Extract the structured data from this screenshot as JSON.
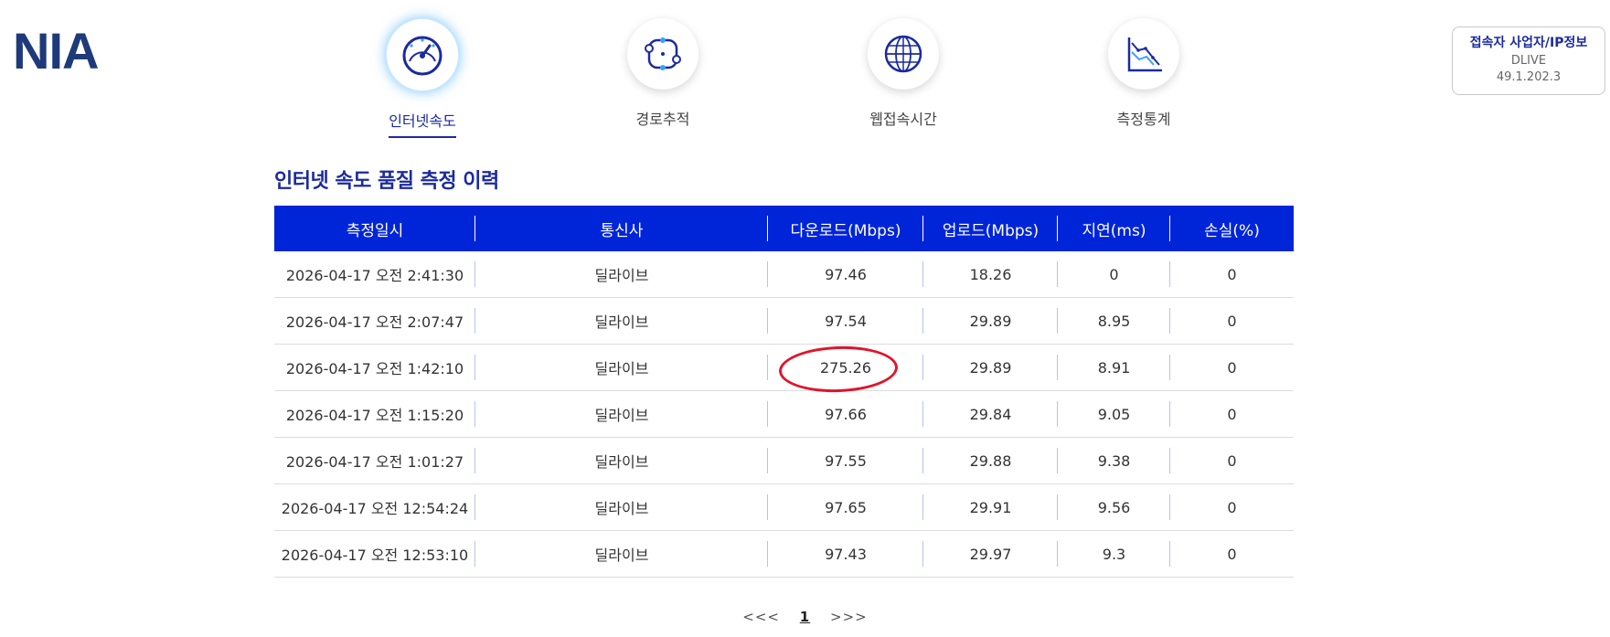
{
  "logo": "NIA",
  "nav": {
    "items": [
      {
        "label": "인터넷속도",
        "icon": "speedometer-icon"
      },
      {
        "label": "경로추적",
        "icon": "route-trace-icon"
      },
      {
        "label": "웹접속시간",
        "icon": "globe-icon"
      },
      {
        "label": "측정통계",
        "icon": "statistics-chart-icon"
      }
    ],
    "active": "인터넷속도"
  },
  "info_box": {
    "title": "접속자 사업자/IP정보",
    "isp": "DLIVE",
    "ip": "49.1.202.3"
  },
  "section_title": "인터넷 속도 품질 측정 이력",
  "table": {
    "headers": [
      "측정일시",
      "통신사",
      "다운로드(Mbps)",
      "업로드(Mbps)",
      "지연(ms)",
      "손실(%)"
    ],
    "rows": [
      [
        "2026-04-17 오전 2:41:30",
        "딜라이브",
        "97.46",
        "18.26",
        "0",
        "0"
      ],
      [
        "2026-04-17 오전 2:07:47",
        "딜라이브",
        "97.54",
        "29.89",
        "8.95",
        "0"
      ],
      [
        "2026-04-17 오전 1:42:10",
        "딜라이브",
        "275.26",
        "29.89",
        "8.91",
        "0"
      ],
      [
        "2026-04-17 오전 1:15:20",
        "딜라이브",
        "97.66",
        "29.84",
        "9.05",
        "0"
      ],
      [
        "2026-04-17 오전 1:01:27",
        "딜라이브",
        "97.55",
        "29.88",
        "9.38",
        "0"
      ],
      [
        "2026-04-17 오전 12:54:24",
        "딜라이브",
        "97.65",
        "29.91",
        "9.56",
        "0"
      ],
      [
        "2026-04-17 오전 12:53:10",
        "딜라이브",
        "97.43",
        "29.97",
        "9.3",
        "0"
      ]
    ]
  },
  "pagination": {
    "prev": "<<<",
    "current": "1",
    "next": ">>>"
  },
  "colors": {
    "brand": "#1b2aa0",
    "table_header": "#0025d9",
    "highlight_mark": "#e0142a"
  }
}
